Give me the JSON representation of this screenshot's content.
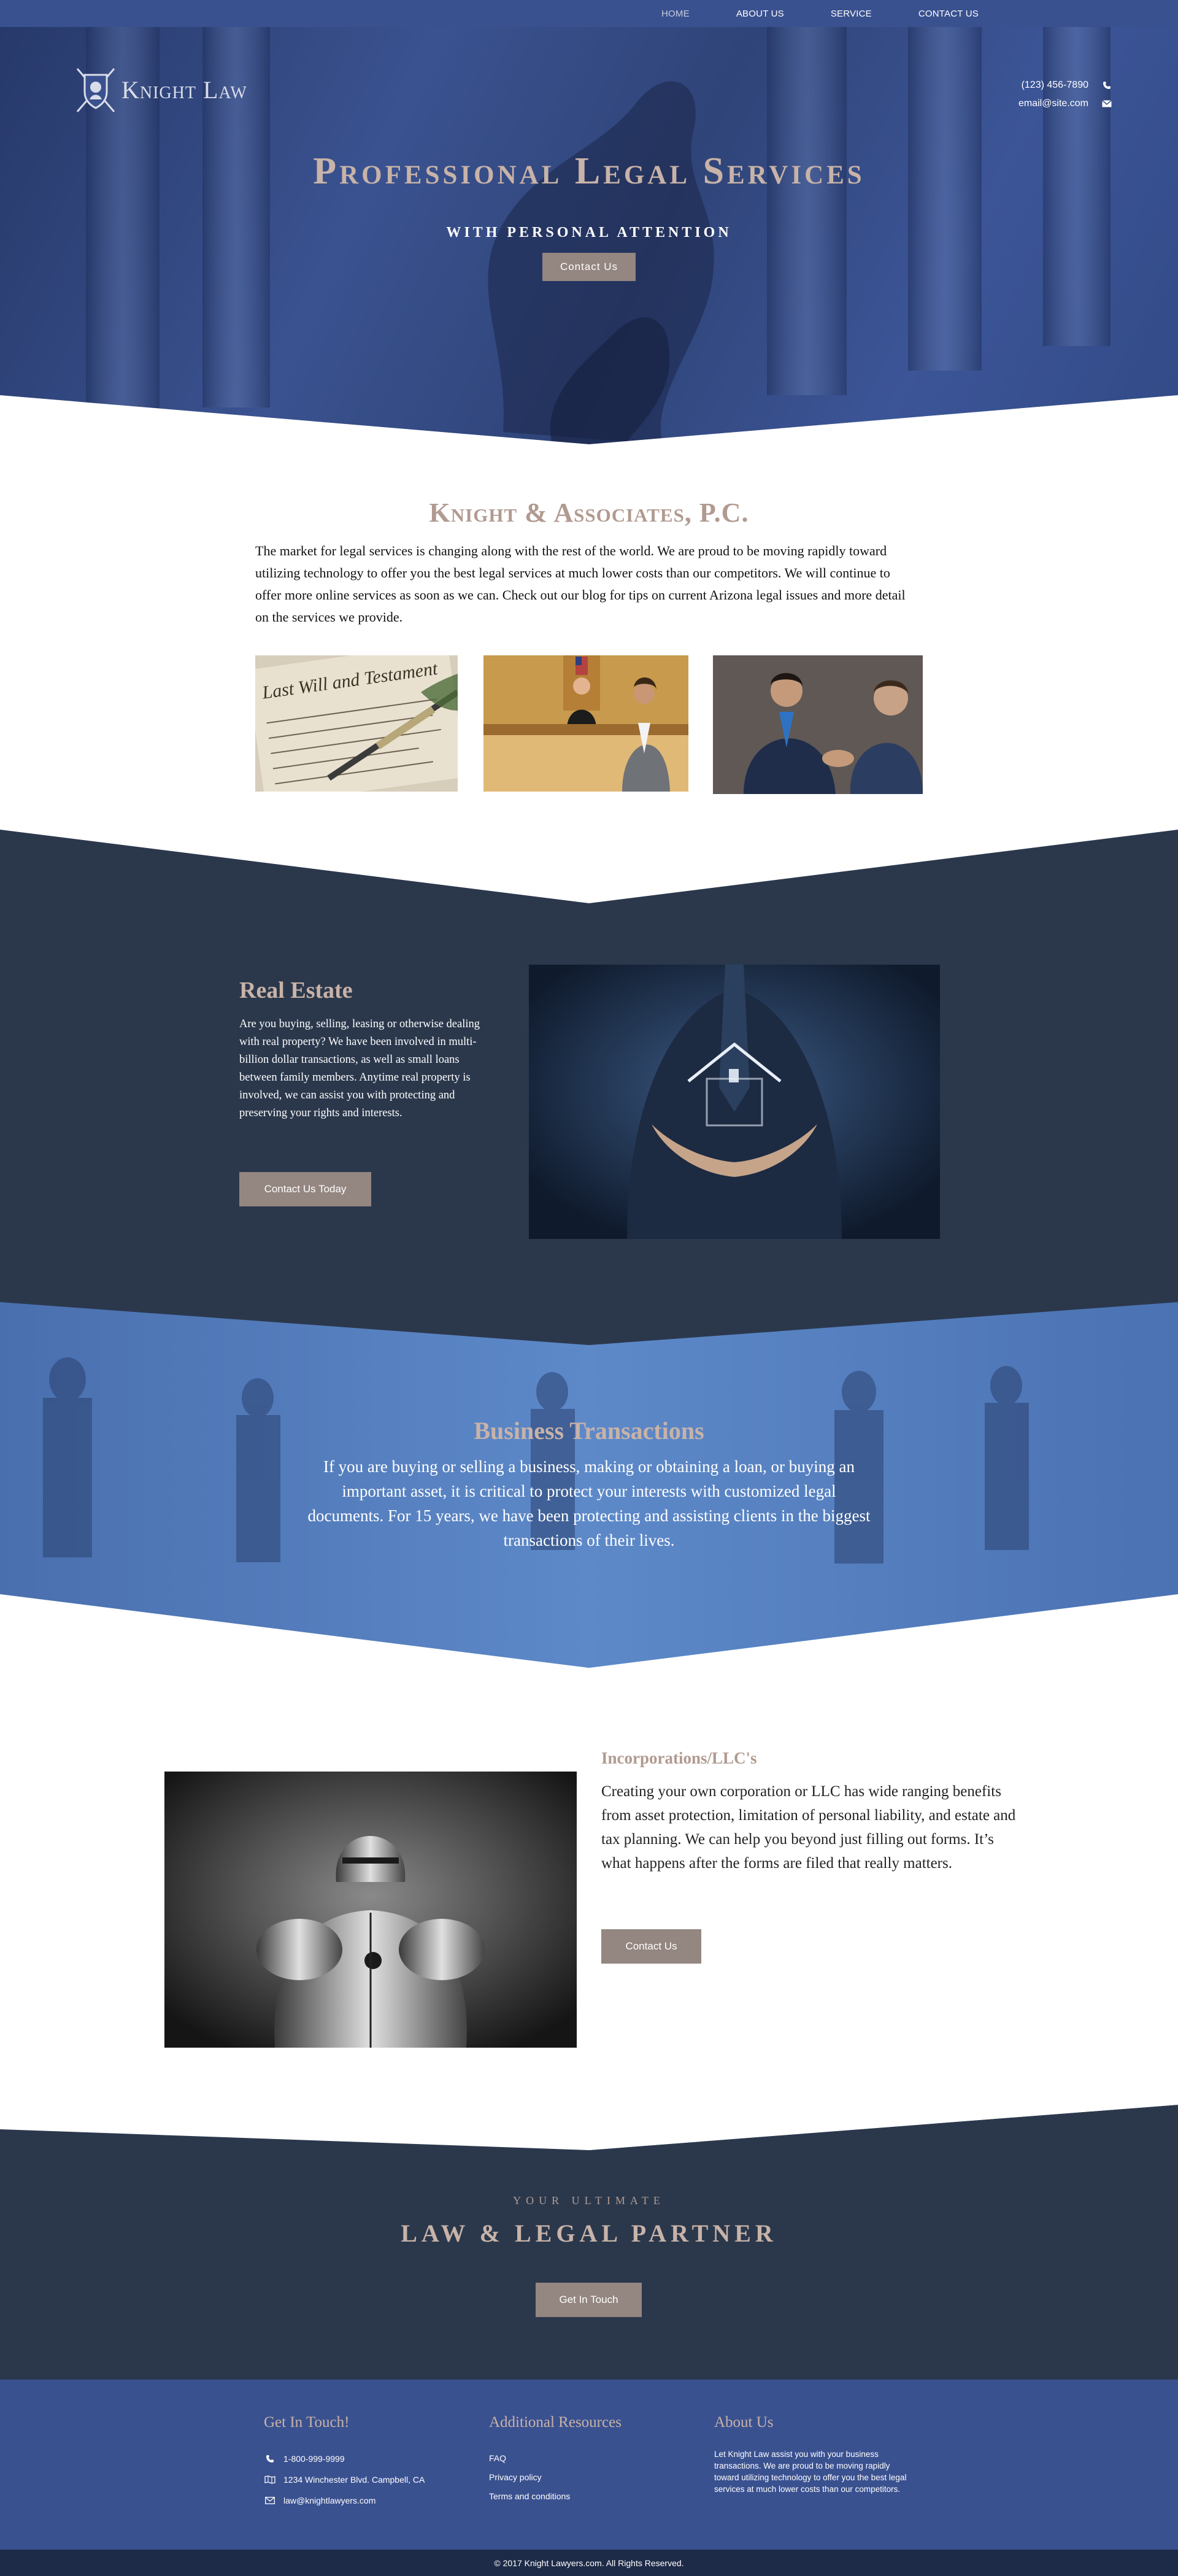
{
  "nav": {
    "items": [
      {
        "label": "HOME",
        "active": true
      },
      {
        "label": "ABOUT US",
        "active": false
      },
      {
        "label": "SERVICE",
        "active": false
      },
      {
        "label": "CONTACT US",
        "active": false
      }
    ]
  },
  "header": {
    "logo_text": "Knight Law",
    "phone": "(123) 456-7890",
    "email": "email@site.com"
  },
  "hero": {
    "title": "Professional Legal Services",
    "subtitle": "with personal attention",
    "button": "Contact Us"
  },
  "about": {
    "title": "Knight & Associates, P.C.",
    "text": "The market for legal services is changing along with the rest of the world. We are proud to be moving rapidly toward utilizing technology to offer you the best legal services at much lower costs than our competitors.    We will continue to offer more online services as soon as we can. Check out our blog for tips on current Arizona legal issues and more detail on the services we provide.",
    "photo1_text": "Last Will and Testament"
  },
  "real_estate": {
    "title": "Real Estate",
    "text": "Are you buying, selling, leasing or otherwise dealing with real property? We have been involved in multi-billion dollar transactions, as well as small loans between family members. Anytime real property is involved, we can assist you with protecting and preserving your rights and interests.",
    "button": "Contact Us Today"
  },
  "business": {
    "title": "Business Transactions",
    "text": "If you are buying or selling a business, making or obtaining a loan, or buying an important asset, it is critical to protect your interests with customized legal documents. For 15 years, we have been protecting and assisting clients in the biggest transactions of their lives."
  },
  "incorporations": {
    "title": "Incorporations/LLC's",
    "text": "Creating your own corporation or LLC has wide ranging benefits from asset protection, limitation of personal liability, and estate and tax planning. We can help you beyond just filling out forms. It’s what happens after the forms are filed that really matters.",
    "button": "Contact Us"
  },
  "partner": {
    "kicker": "Your ultimate",
    "title": "Law & Legal Partner",
    "button": "Get In Touch"
  },
  "footer": {
    "get_in_touch": {
      "title": "Get In Touch!",
      "phone": "1-800-999-9999",
      "address": "1234 Winchester Blvd. Campbell, CA",
      "email": "law@knightlawyers.com"
    },
    "resources": {
      "title": "Additional Resources",
      "links": [
        "FAQ",
        "Privacy policy",
        "Terms and conditions"
      ]
    },
    "about": {
      "title": "About Us",
      "text": "Let Knight Law assist you with your business transactions. We are proud to be moving rapidly toward utilizing technology to offer you the best legal services at much lower costs than our competitors."
    },
    "copyright": "© 2017 Knight Lawyers.com. All Rights Reserved."
  },
  "colors": {
    "nav_blue": "#3a5190",
    "dark_slate": "#2b384c",
    "accent_taupe": "#948680",
    "heading_rose": "#c8b3a8",
    "copyright_bar": "#1e2b48"
  }
}
